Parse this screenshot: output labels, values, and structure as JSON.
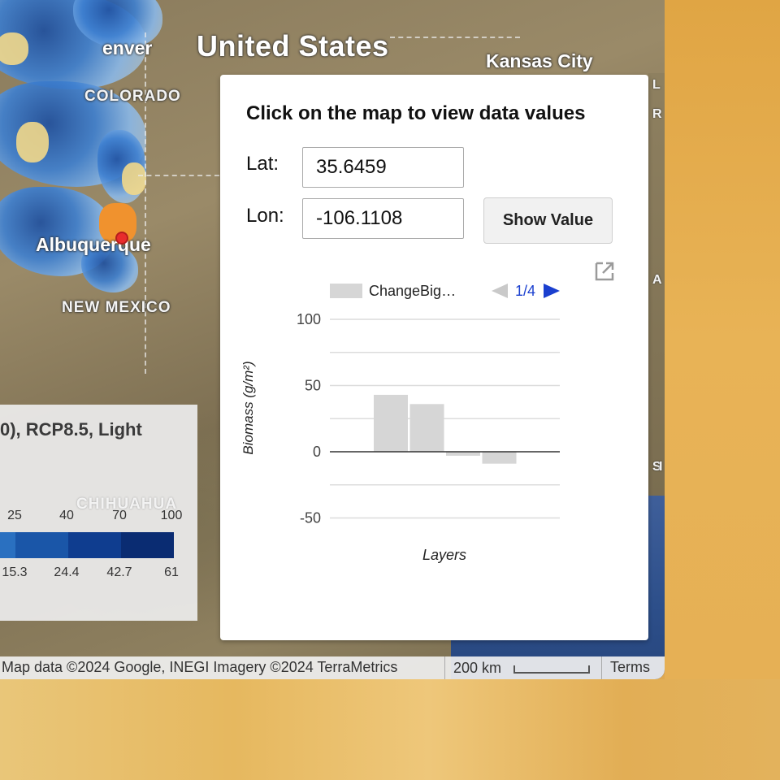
{
  "map": {
    "country_label": "United States",
    "city_labels": {
      "denver": "enver",
      "kansas_city": "Kansas City",
      "albuquerque": "Albuquerque"
    },
    "state_labels": {
      "colorado": "COLORADO",
      "new_mexico": "NEW MEXICO",
      "chihuahua": "CHIHUAHUA"
    },
    "right_edge_letters": [
      "L",
      "R",
      "A",
      "S",
      "I"
    ]
  },
  "legend": {
    "title": "0), RCP8.5, Light",
    "top_ticks": [
      "25",
      "40",
      "70",
      "100"
    ],
    "bottom_ticks": [
      "15.3",
      "24.4",
      "42.7",
      "61"
    ],
    "colors": [
      "#3d8ad4",
      "#2a70c0",
      "#1a56a8",
      "#0f3d8f",
      "#0a2c72"
    ]
  },
  "attribution": {
    "text": "Map data ©2024 Google, INEGI Imagery ©2024 TerraMetrics",
    "scale": "200 km",
    "terms": "Terms"
  },
  "inspector": {
    "heading": "Click on the map to view data values",
    "lat_label": "Lat:",
    "lat_value": "35.6459",
    "lon_label": "Lon:",
    "lon_value": "-106.1108",
    "button_label": "Show Value",
    "popout_icon": "open-in-new-icon"
  },
  "chart_data": {
    "type": "bar",
    "title": "",
    "xlabel": "Layers",
    "ylabel": "Biomass (g/m²)",
    "ylim": [
      -60,
      100
    ],
    "yticks": [
      -50,
      0,
      50,
      100
    ],
    "grid": true,
    "legend": {
      "placement": "top",
      "entry": "ChangeBig…",
      "page": "1/4"
    },
    "series": [
      {
        "values": [
          43,
          36,
          -3,
          -9
        ]
      }
    ],
    "bar_color": "#d6d6d6"
  }
}
